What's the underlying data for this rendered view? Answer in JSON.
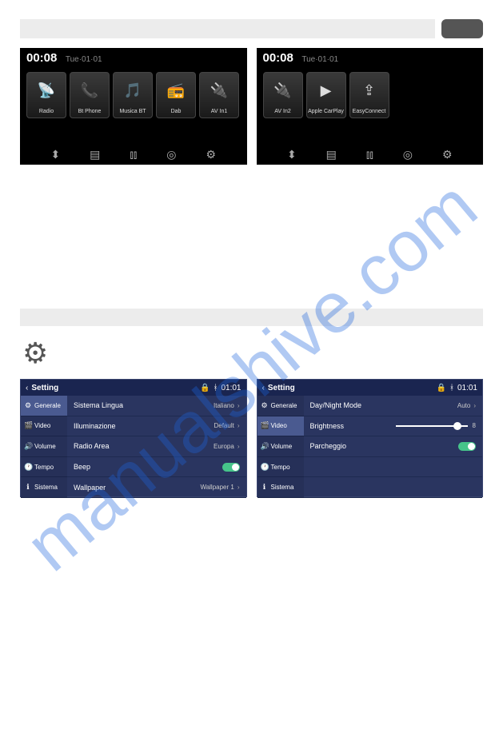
{
  "home_left": {
    "time": "00:08",
    "date": "Tue·01·01",
    "tiles": [
      {
        "label": "Radio",
        "icon": "📡"
      },
      {
        "label": "Bt Phone",
        "icon": "📞"
      },
      {
        "label": "Musica BT",
        "icon": "🎵"
      },
      {
        "label": "Dab",
        "icon": "📻"
      },
      {
        "label": "AV In1",
        "icon": "🔌"
      }
    ],
    "bottom_icons": [
      "usb-icon",
      "sd-icon",
      "eq-icon",
      "wheel-icon",
      "gear-icon"
    ]
  },
  "home_right": {
    "time": "00:08",
    "date": "Tue·01·01",
    "tiles": [
      {
        "label": "AV In2",
        "icon": "🔌"
      },
      {
        "label": "Apple CarPlay",
        "icon": "▶"
      },
      {
        "label": "EasyConnect",
        "icon": "⇪"
      }
    ],
    "bottom_icons": [
      "usb-icon",
      "sd-icon",
      "eq-icon",
      "wheel-icon",
      "gear-icon"
    ]
  },
  "settings_left": {
    "header_title": "Setting",
    "header_time": "01:01",
    "sidebar": [
      {
        "icon": "⚙",
        "label": "Generale",
        "active": true
      },
      {
        "icon": "🎬",
        "label": "Video"
      },
      {
        "icon": "🔊",
        "label": "Volume"
      },
      {
        "icon": "🕐",
        "label": "Tempo"
      },
      {
        "icon": "ℹ",
        "label": "Sistema"
      }
    ],
    "rows": [
      {
        "label": "Sistema Lingua",
        "value": "Italiano",
        "chevron": true
      },
      {
        "label": "Illuminazione",
        "value": "Default",
        "chevron": true
      },
      {
        "label": "Radio Area",
        "value": "Europa",
        "chevron": true
      },
      {
        "label": "Beep",
        "toggle": true
      },
      {
        "label": "Wallpaper",
        "value": "Wallpaper 1",
        "chevron": true
      }
    ]
  },
  "settings_right": {
    "header_title": "Setting",
    "header_time": "01:01",
    "sidebar": [
      {
        "icon": "⚙",
        "label": "Generale"
      },
      {
        "icon": "🎬",
        "label": "Video",
        "active": true
      },
      {
        "icon": "🔊",
        "label": "Volume"
      },
      {
        "icon": "🕐",
        "label": "Tempo"
      },
      {
        "icon": "ℹ",
        "label": "Sistema"
      }
    ],
    "rows": [
      {
        "label": "Day/Night Mode",
        "value": "Auto",
        "chevron": true
      },
      {
        "label": "Brightness",
        "slider": true,
        "slider_value": "8"
      },
      {
        "label": "Parcheggio",
        "toggle": true
      },
      {
        "label": ""
      },
      {
        "label": ""
      }
    ]
  },
  "watermark": "manualshive.com"
}
